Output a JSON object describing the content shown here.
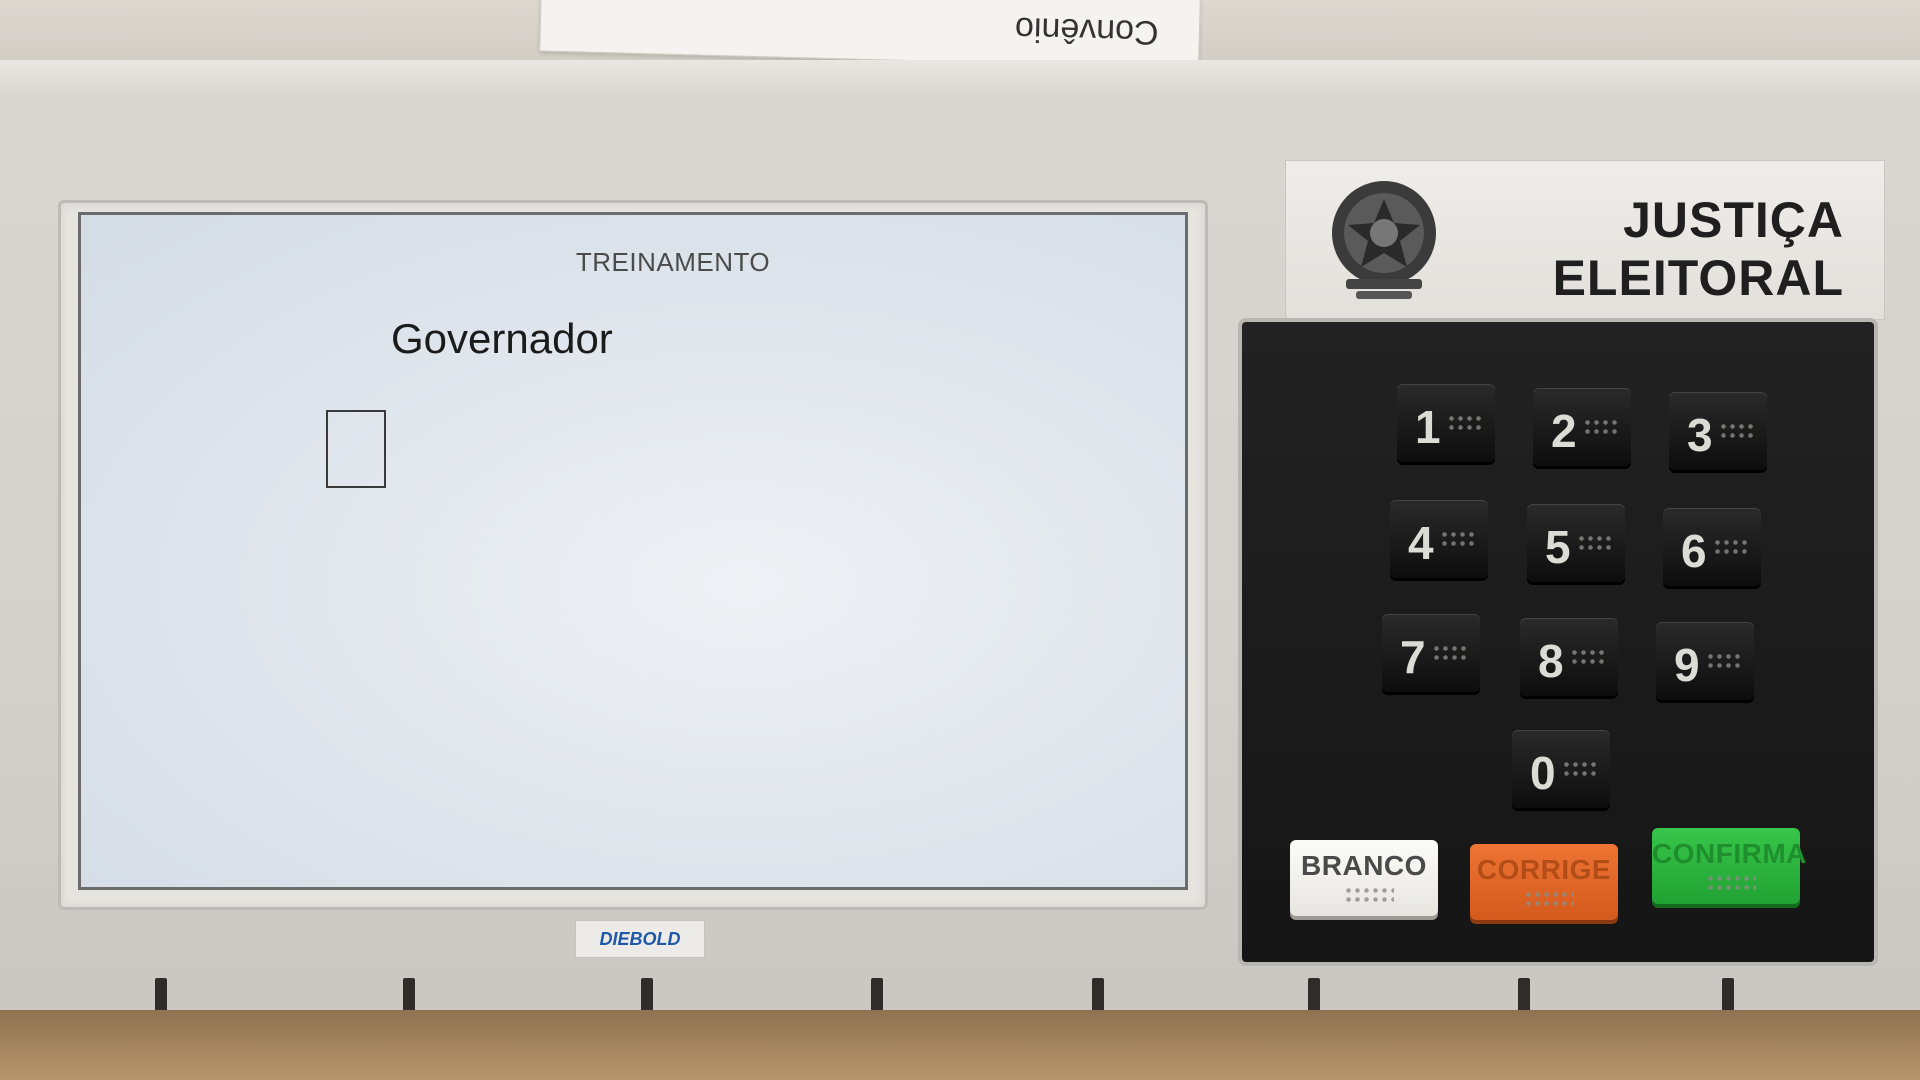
{
  "paper_label": {
    "text": "Convênio"
  },
  "screen": {
    "mode": "TREINAMENTO",
    "office": "Governador"
  },
  "brand": {
    "name": "DIEBOLD"
  },
  "authority": {
    "line1": "JUSTIÇA",
    "line2": "ELEITORAL"
  },
  "keypad": {
    "digits": [
      "1",
      "2",
      "3",
      "4",
      "5",
      "6",
      "7",
      "8",
      "9",
      "0"
    ],
    "blank_label": "BRANCO",
    "correct_label": "CORRIGE",
    "confirm_label": "CONFIRMA"
  },
  "colors": {
    "blank_key": "#f2f1ed",
    "correct_key": "#e3692a",
    "confirm_key": "#2fb640",
    "keypad_bg": "#1a1a1a",
    "screen_bg": "#e2e8ee"
  },
  "icons": {
    "emblem": "coat-of-arms-icon"
  }
}
